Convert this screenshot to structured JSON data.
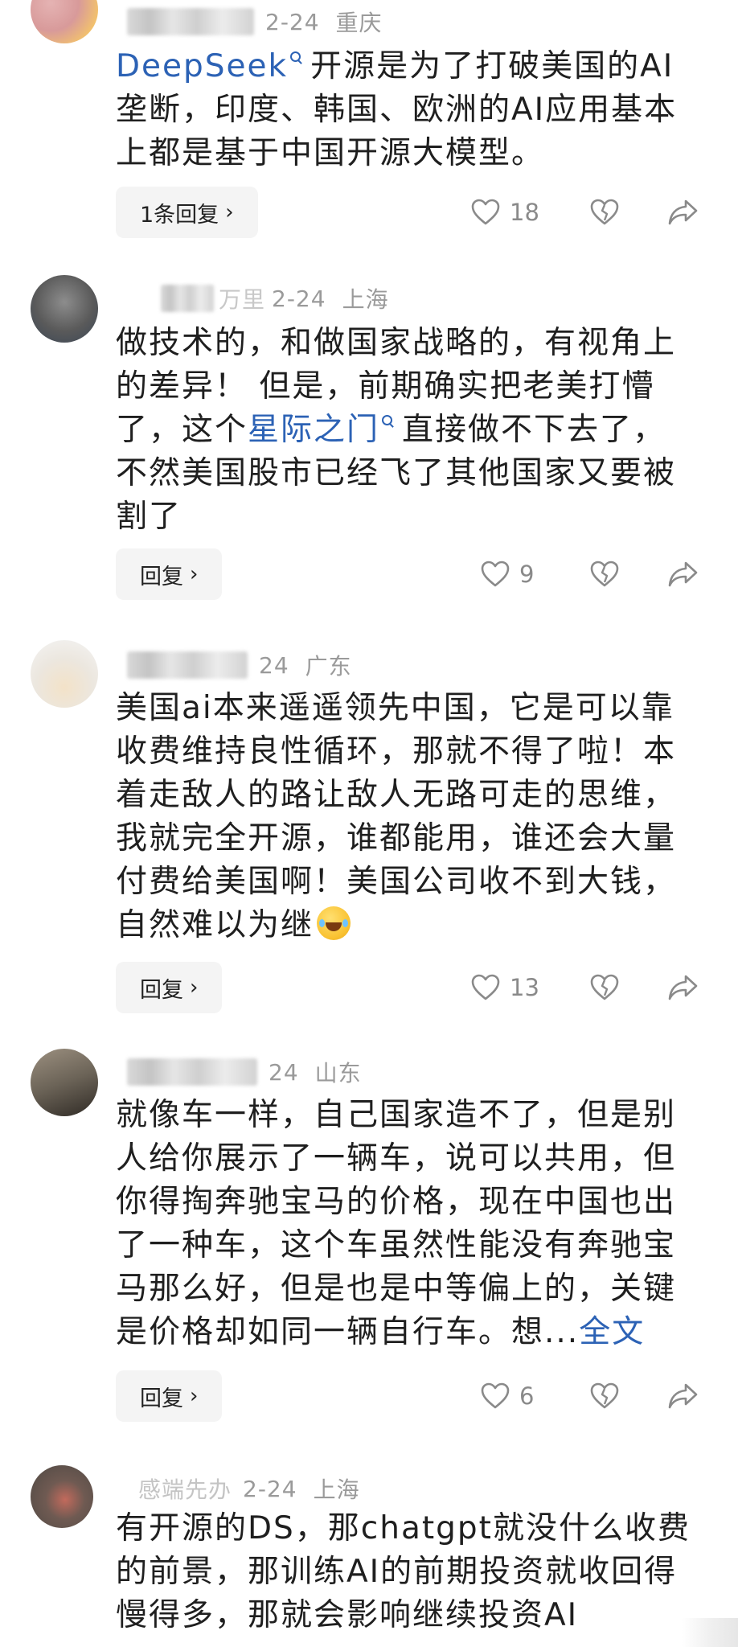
{
  "comments": [
    {
      "date": "2-24",
      "location": "重庆",
      "text_link": "DeepSeek",
      "text_line1_rest": "开源是为了打破美国的AI",
      "text_line2": "垄断，印度、韩国、欧洲的AI应用基本",
      "text_line3": "上都是基于中国开源大模型。",
      "reply_label": "1条回复",
      "likes": "18"
    },
    {
      "name_visible": "万里",
      "date": "2-24",
      "location": "上海",
      "text_line1": "做技术的，和做国家战略的，有视角上",
      "text_line2": "的差异！ 但是，前期确实把老美打懵",
      "text_line3_pre": "了，这个",
      "text_link": "星际之门",
      "text_line3_post": "直接做不下去了，",
      "text_line4": "不然美国股市已经飞了其他国家又要被",
      "text_line5": "割了",
      "reply_label": "回复",
      "likes": "9"
    },
    {
      "date": "24",
      "location": "广东",
      "text_line1": "美国ai本来遥遥领先中国，它是可以靠",
      "text_line2": "收费维持良性循环，那就不得了啦！本",
      "text_line3": "着走敌人的路让敌人无路可走的思维，",
      "text_line4": "我就完全开源，谁都能用，谁还会大量",
      "text_line5": "付费给美国啊！美国公司收不到大钱，",
      "text_line6": "自然难以为继",
      "reply_label": "回复",
      "likes": "13"
    },
    {
      "date": "24",
      "location": "山东",
      "text_line1": "就像车一样，自己国家造不了，但是别",
      "text_line2": "人给你展示了一辆车，说可以共用，但",
      "text_line3": "你得掏奔驰宝马的价格，现在中国也出",
      "text_line4": "了一种车，这个车虽然性能没有奔驰宝",
      "text_line5": "马那么好，但是也是中等偏上的，关键",
      "text_line6": "是价格却如同一辆自行车。想",
      "ellipsis": "...",
      "more_link": "全文",
      "reply_label": "回复",
      "likes": "6"
    },
    {
      "name_visible": "感端先办",
      "date": "2-24",
      "location": "上海",
      "text_line1": "有开源的DS，那chatgpt就没什么收费",
      "text_line2": "的前景，那训练AI的前期投资就收回得",
      "text_line3": "慢得多，那就会影响继续投资AI"
    }
  ],
  "colors": {
    "link": "#2c62b5",
    "meta": "#9a9a9a",
    "reply_bg": "#f4f4f4",
    "icon": "#8a8a8a"
  },
  "icons": [
    "heart-icon",
    "dislike-heart-icon",
    "share-icon",
    "chevron-right-icon",
    "search-icon",
    "laughing-emoji"
  ]
}
